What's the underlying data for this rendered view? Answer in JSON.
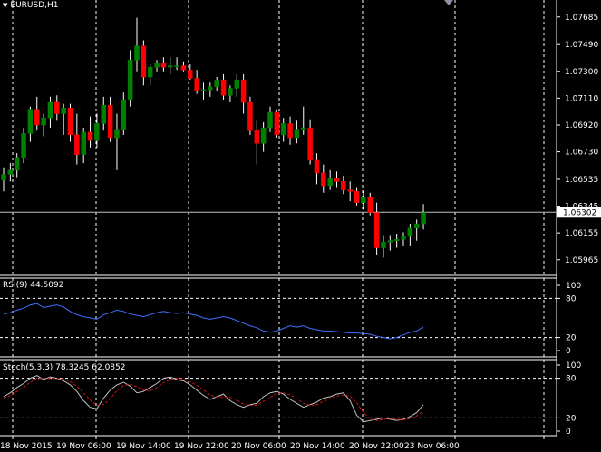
{
  "main": {
    "arrow": "▼",
    "symbol_label": "EURUSD,H1",
    "current_price": "1.06302"
  },
  "rsi": {
    "label": "RSI(9) 44.5092"
  },
  "stoch": {
    "label": "Stoch(5,3,3) 78.3245 62.0852"
  },
  "colors": {
    "bull": "#008000",
    "bear": "#ff0000",
    "rsi_line": "#3f6fff",
    "stoch_main": "#c0c0c0",
    "stoch_signal": "#d01010"
  },
  "chart_data": [
    {
      "type": "candlestick",
      "title": "EURUSD,H1",
      "xlabel": "",
      "ylabel": "",
      "ylim": [
        1.0588,
        1.0778
      ],
      "y_ticks": [
        "1.07685",
        "1.07490",
        "1.07300",
        "1.07110",
        "1.06920",
        "1.06730",
        "1.06535",
        "1.06345",
        "1.06155",
        "1.05965"
      ],
      "x_ticks": [
        "18 Nov 2015",
        "19 Nov 06:00",
        "19 Nov 14:00",
        "19 Nov 22:00",
        "20 Nov 06:00",
        "20 Nov 14:00",
        "20 Nov 22:00",
        "23 Nov 06:00"
      ],
      "candles": [
        [
          1.0653,
          1.0662,
          1.0645,
          1.0657
        ],
        [
          1.0657,
          1.0665,
          1.0652,
          1.066
        ],
        [
          1.066,
          1.0672,
          1.0655,
          1.0669
        ],
        [
          1.0669,
          1.069,
          1.0665,
          1.0686
        ],
        [
          1.0686,
          1.0705,
          1.068,
          1.0703
        ],
        [
          1.0703,
          1.0712,
          1.0688,
          1.0692
        ],
        [
          1.0692,
          1.07,
          1.0684,
          1.0697
        ],
        [
          1.0697,
          1.0712,
          1.069,
          1.0708
        ],
        [
          1.0708,
          1.0713,
          1.0695,
          1.07
        ],
        [
          1.07,
          1.0707,
          1.0685,
          1.0704
        ],
        [
          1.0704,
          1.0707,
          1.068,
          1.0685
        ],
        [
          1.0685,
          1.07,
          1.0664,
          1.0671
        ],
        [
          1.0671,
          1.069,
          1.0665,
          1.0687
        ],
        [
          1.0687,
          1.0698,
          1.0676,
          1.0681
        ],
        [
          1.0681,
          1.07,
          1.0676,
          1.0693
        ],
        [
          1.0693,
          1.0712,
          1.0688,
          1.0706
        ],
        [
          1.0706,
          1.0712,
          1.068,
          1.0683
        ],
        [
          1.0683,
          1.07,
          1.066,
          1.0689
        ],
        [
          1.0689,
          1.0715,
          1.0685,
          1.071
        ],
        [
          1.071,
          1.0745,
          1.0705,
          1.0738
        ],
        [
          1.0738,
          1.0768,
          1.073,
          1.0748
        ],
        [
          1.0748,
          1.0752,
          1.072,
          1.0726
        ],
        [
          1.0726,
          1.0735,
          1.072,
          1.0733
        ],
        [
          1.0733,
          1.0738,
          1.073,
          1.0736
        ],
        [
          1.0736,
          1.074,
          1.073,
          1.0733
        ],
        [
          1.0733,
          1.074,
          1.0728,
          1.0734
        ],
        [
          1.0734,
          1.074,
          1.0731,
          1.0734
        ],
        [
          1.0734,
          1.0737,
          1.073,
          1.0731
        ],
        [
          1.0731,
          1.0735,
          1.0724,
          1.0725
        ],
        [
          1.0725,
          1.0731,
          1.0714,
          1.0716
        ],
        [
          1.0716,
          1.0722,
          1.071,
          1.0717
        ],
        [
          1.0717,
          1.0722,
          1.0712,
          1.0719
        ],
        [
          1.0719,
          1.0726,
          1.0716,
          1.0724
        ],
        [
          1.0724,
          1.0728,
          1.071,
          1.0713
        ],
        [
          1.0713,
          1.072,
          1.0708,
          1.0718
        ],
        [
          1.0718,
          1.0728,
          1.0712,
          1.0724
        ],
        [
          1.0724,
          1.0728,
          1.07,
          1.0708
        ],
        [
          1.0708,
          1.0712,
          1.0685,
          1.0688
        ],
        [
          1.0688,
          1.0696,
          1.0664,
          1.0679
        ],
        [
          1.0679,
          1.0694,
          1.0673,
          1.069
        ],
        [
          1.069,
          1.0705,
          1.0687,
          1.0701
        ],
        [
          1.0701,
          1.0703,
          1.0683,
          1.0685
        ],
        [
          1.0685,
          1.0697,
          1.068,
          1.0693
        ],
        [
          1.0693,
          1.0698,
          1.0678,
          1.0683
        ],
        [
          1.0683,
          1.0695,
          1.0679,
          1.0689
        ],
        [
          1.0689,
          1.0705,
          1.0685,
          1.069
        ],
        [
          1.069,
          1.0696,
          1.0664,
          1.0667
        ],
        [
          1.0667,
          1.0672,
          1.065,
          1.0658
        ],
        [
          1.0658,
          1.0664,
          1.0644,
          1.0649
        ],
        [
          1.0649,
          1.066,
          1.0646,
          1.0654
        ],
        [
          1.0654,
          1.0659,
          1.0648,
          1.0652
        ],
        [
          1.0652,
          1.0656,
          1.0643,
          1.0646
        ],
        [
          1.0646,
          1.0652,
          1.0638,
          1.0645
        ],
        [
          1.0645,
          1.0648,
          1.0635,
          1.0637
        ],
        [
          1.0637,
          1.0645,
          1.0632,
          1.0641
        ],
        [
          1.0641,
          1.0644,
          1.0628,
          1.063
        ],
        [
          1.063,
          1.0637,
          1.06,
          1.0605
        ],
        [
          1.0605,
          1.0614,
          1.0598,
          1.0609
        ],
        [
          1.0609,
          1.0614,
          1.0603,
          1.061
        ],
        [
          1.061,
          1.0615,
          1.0605,
          1.0611
        ],
        [
          1.0611,
          1.0616,
          1.0606,
          1.0613
        ],
        [
          1.0613,
          1.0622,
          1.0606,
          1.0619
        ],
        [
          1.0619,
          1.0625,
          1.061,
          1.0622
        ],
        [
          1.0622,
          1.0636,
          1.0618,
          1.063
        ]
      ]
    },
    {
      "type": "line",
      "title": "RSI(9) 44.5092",
      "xlabel": "",
      "ylabel": "",
      "ylim": [
        0,
        100
      ],
      "y_ticks": [
        "100",
        "80",
        "20",
        "0"
      ],
      "series": [
        {
          "values": [
            56,
            58,
            62,
            65,
            70,
            72,
            66,
            68,
            70,
            67,
            60,
            55,
            52,
            50,
            48,
            55,
            58,
            62,
            60,
            56,
            54,
            52,
            55,
            58,
            60,
            58,
            57,
            58,
            56,
            54,
            50,
            48,
            50,
            52,
            50,
            46,
            42,
            38,
            35,
            30,
            28,
            30,
            34,
            38,
            36,
            38,
            34,
            32,
            30,
            30,
            29,
            28,
            27,
            27,
            26,
            25,
            22,
            20,
            18,
            20,
            24,
            28,
            30,
            36
          ]
        }
      ]
    },
    {
      "type": "line",
      "title": "Stoch(5,3,3) 78.3245 62.0852",
      "xlabel": "",
      "ylabel": "",
      "ylim": [
        0,
        100
      ],
      "y_ticks": [
        "100",
        "80",
        "20",
        "0"
      ],
      "series": [
        {
          "values": [
            52,
            58,
            66,
            72,
            80,
            84,
            78,
            82,
            80,
            76,
            70,
            60,
            46,
            36,
            34,
            50,
            62,
            70,
            74,
            68,
            58,
            60,
            66,
            72,
            80,
            82,
            78,
            76,
            70,
            62,
            54,
            48,
            52,
            56,
            46,
            40,
            36,
            40,
            42,
            52,
            58,
            60,
            56,
            48,
            42,
            36,
            40,
            44,
            50,
            52,
            56,
            58,
            46,
            24,
            14,
            16,
            18,
            20,
            18,
            16,
            18,
            22,
            28,
            40
          ]
        },
        {
          "values": [
            50,
            54,
            60,
            66,
            74,
            80,
            80,
            80,
            80,
            79,
            75,
            68,
            58,
            47,
            39,
            40,
            49,
            61,
            69,
            71,
            67,
            62,
            61,
            66,
            73,
            78,
            80,
            79,
            75,
            69,
            62,
            55,
            51,
            52,
            51,
            47,
            41,
            39,
            39,
            45,
            51,
            57,
            58,
            55,
            49,
            42,
            39,
            40,
            45,
            49,
            53,
            55,
            53,
            43,
            28,
            18,
            16,
            18,
            19,
            18,
            17,
            19,
            23,
            30
          ]
        }
      ]
    }
  ]
}
